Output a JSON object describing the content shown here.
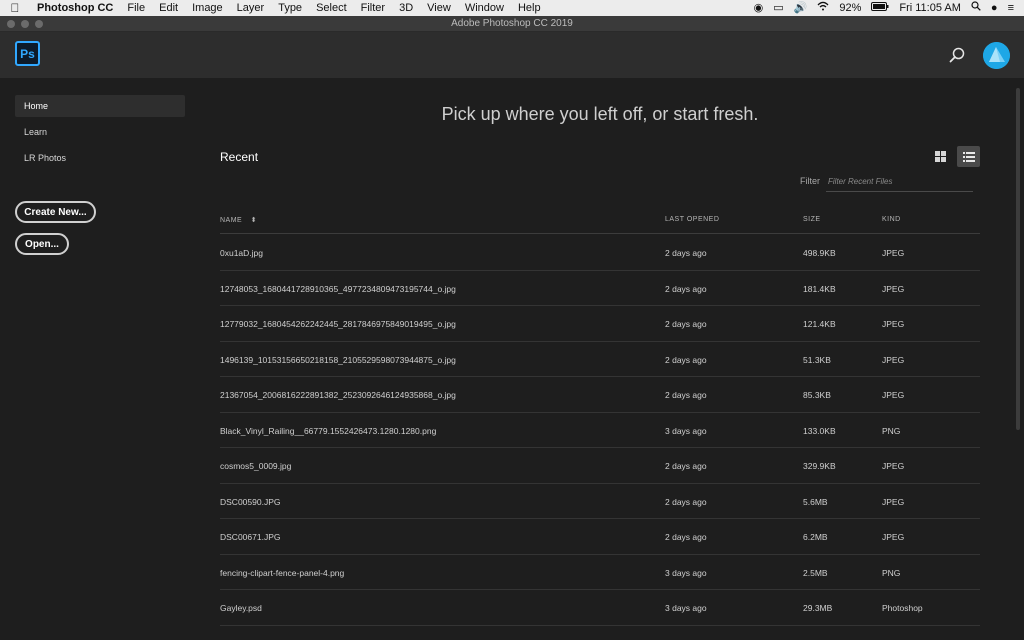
{
  "menubar": {
    "app_name": "Photoshop CC",
    "items": [
      "File",
      "Edit",
      "Image",
      "Layer",
      "Type",
      "Select",
      "Filter",
      "3D",
      "View",
      "Window",
      "Help"
    ],
    "battery": "92%",
    "clock": "Fri 11:05 AM"
  },
  "window": {
    "title": "Adobe Photoshop CC 2019"
  },
  "header": {
    "logo_text": "Ps"
  },
  "sidebar": {
    "items": [
      {
        "label": "Home"
      },
      {
        "label": "Learn"
      },
      {
        "label": "LR Photos"
      }
    ],
    "create_new_label": "Create New...",
    "open_label": "Open..."
  },
  "main": {
    "headline": "Pick up where you left off, or start fresh.",
    "recent_title": "Recent",
    "filter_label": "Filter",
    "filter_placeholder": "Filter Recent Files",
    "columns": {
      "name": "NAME",
      "sort_indicator": "⬍",
      "last_opened": "LAST OPENED",
      "size": "SIZE",
      "kind": "KIND"
    },
    "files": [
      {
        "name": "0xu1aD.jpg",
        "opened": "2 days ago",
        "size": "498.9KB",
        "kind": "JPEG"
      },
      {
        "name": "12748053_1680441728910365_4977234809473195744_o.jpg",
        "opened": "2 days ago",
        "size": "181.4KB",
        "kind": "JPEG"
      },
      {
        "name": "12779032_1680454262242445_2817846975849019495_o.jpg",
        "opened": "2 days ago",
        "size": "121.4KB",
        "kind": "JPEG"
      },
      {
        "name": "1496139_10153156650218158_2105529598073944875_o.jpg",
        "opened": "2 days ago",
        "size": "51.3KB",
        "kind": "JPEG"
      },
      {
        "name": "21367054_2006816222891382_2523092646124935868_o.jpg",
        "opened": "2 days ago",
        "size": "85.3KB",
        "kind": "JPEG"
      },
      {
        "name": "Black_Vinyl_Railing__66779.1552426473.1280.1280.png",
        "opened": "3 days ago",
        "size": "133.0KB",
        "kind": "PNG"
      },
      {
        "name": "cosmos5_0009.jpg",
        "opened": "2 days ago",
        "size": "329.9KB",
        "kind": "JPEG"
      },
      {
        "name": "DSC00590.JPG",
        "opened": "2 days ago",
        "size": "5.6MB",
        "kind": "JPEG"
      },
      {
        "name": "DSC00671.JPG",
        "opened": "2 days ago",
        "size": "6.2MB",
        "kind": "JPEG"
      },
      {
        "name": "fencing-clipart-fence-panel-4.png",
        "opened": "3 days ago",
        "size": "2.5MB",
        "kind": "PNG"
      },
      {
        "name": "Gayley.psd",
        "opened": "3 days ago",
        "size": "29.3MB",
        "kind": "Photoshop"
      }
    ]
  },
  "colors": {
    "accent": "#31a8ff",
    "background": "#1e1e1e",
    "header": "#2d2d2d"
  }
}
